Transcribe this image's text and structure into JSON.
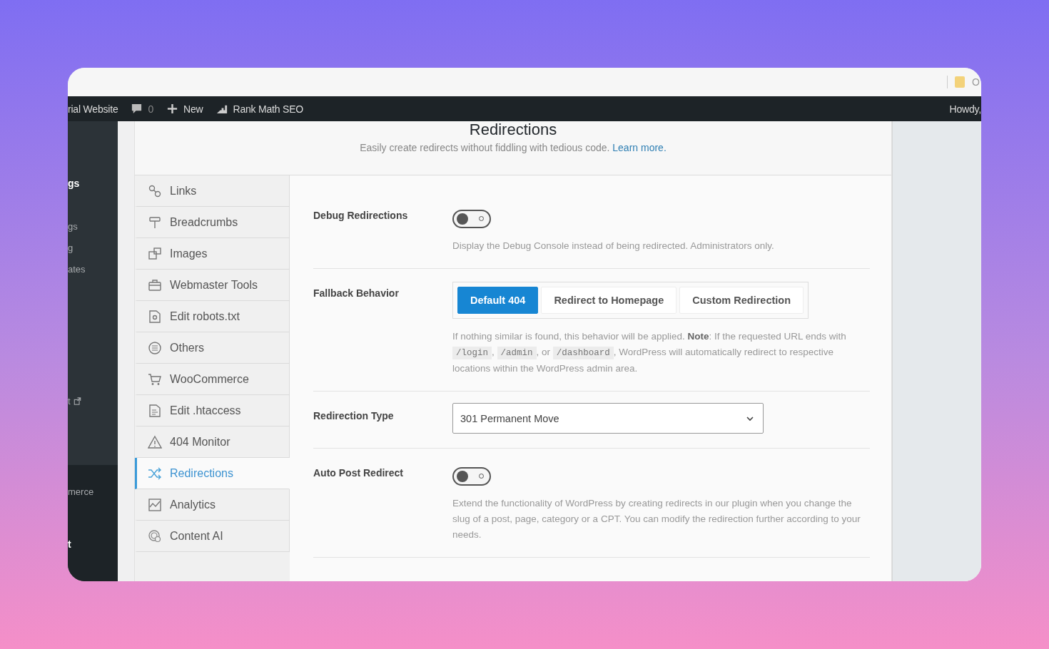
{
  "browser": {
    "tab_text": "O"
  },
  "admin_bar": {
    "items": [
      {
        "kind": "site",
        "label": "rial Website"
      },
      {
        "kind": "comments",
        "label": "0"
      },
      {
        "kind": "new",
        "label": "New"
      },
      {
        "kind": "plugin",
        "label": "Rank Math SEO"
      }
    ],
    "greeting": "Howdy,"
  },
  "admin_menu": {
    "groups": [
      {
        "kind": "menu",
        "items": [
          {
            "label": "gs",
            "emphasis": true,
            "external": false
          },
          {
            "label": "gs",
            "emphasis": false,
            "external": false
          },
          {
            "label": "g",
            "emphasis": false,
            "external": false
          },
          {
            "label": "ates",
            "emphasis": false,
            "external": false
          },
          {
            "label": "t",
            "emphasis": false,
            "external": true
          }
        ]
      },
      {
        "kind": "submenu",
        "items": [
          {
            "label": "merce",
            "emphasis": false,
            "external": false
          },
          {
            "label": "t",
            "emphasis": true,
            "external": false
          }
        ]
      }
    ]
  },
  "page": {
    "title": "Redirections",
    "subtitle": "Easily create redirects without fiddling with tedious code.",
    "subtitle_link": "Learn more."
  },
  "tabs": [
    {
      "label": "Links",
      "selected": false
    },
    {
      "label": "Breadcrumbs",
      "selected": false
    },
    {
      "label": "Images",
      "selected": false
    },
    {
      "label": "Webmaster Tools",
      "selected": false
    },
    {
      "label": "Edit robots.txt",
      "selected": false
    },
    {
      "label": "Others",
      "selected": false
    },
    {
      "label": "WooCommerce",
      "selected": false
    },
    {
      "label": "Edit .htaccess",
      "selected": false
    },
    {
      "label": "404 Monitor",
      "selected": false
    },
    {
      "label": "Redirections",
      "selected": true
    },
    {
      "label": "Analytics",
      "selected": false
    },
    {
      "label": "Content AI",
      "selected": false
    }
  ],
  "settings": [
    {
      "kind": "toggle",
      "label": "Debug Redirections",
      "on": false,
      "description": [
        {
          "kind": "text",
          "text": "Display the Debug Console instead of being redirected. Administrators only."
        }
      ]
    },
    {
      "kind": "buttons",
      "label": "Fallback Behavior",
      "options": [
        {
          "label": "Default 404",
          "selected": true
        },
        {
          "label": "Redirect to Homepage",
          "selected": false
        },
        {
          "label": "Custom Redirection",
          "selected": false
        }
      ],
      "description": [
        {
          "kind": "text",
          "text": "If nothing similar is found, this behavior will be applied. **Note**: If the requested URL ends with "
        },
        {
          "kind": "code",
          "text": "/login"
        },
        {
          "kind": "text",
          "text": ", "
        },
        {
          "kind": "code",
          "text": "/admin"
        },
        {
          "kind": "text",
          "text": ", or "
        },
        {
          "kind": "code",
          "text": "/dashboard"
        },
        {
          "kind": "text",
          "text": ", WordPress will automatically redirect to respective locations within the WordPress admin area."
        }
      ]
    },
    {
      "kind": "select",
      "label": "Redirection Type",
      "value": "301 Permanent Move"
    },
    {
      "kind": "toggle",
      "label": "Auto Post Redirect",
      "on": false,
      "description": [
        {
          "kind": "text",
          "text": "Extend the functionality of WordPress by creating redirects in our plugin when you change the slug of a post, page, category or a CPT. You can modify the redirection further according to your needs."
        }
      ]
    }
  ]
}
